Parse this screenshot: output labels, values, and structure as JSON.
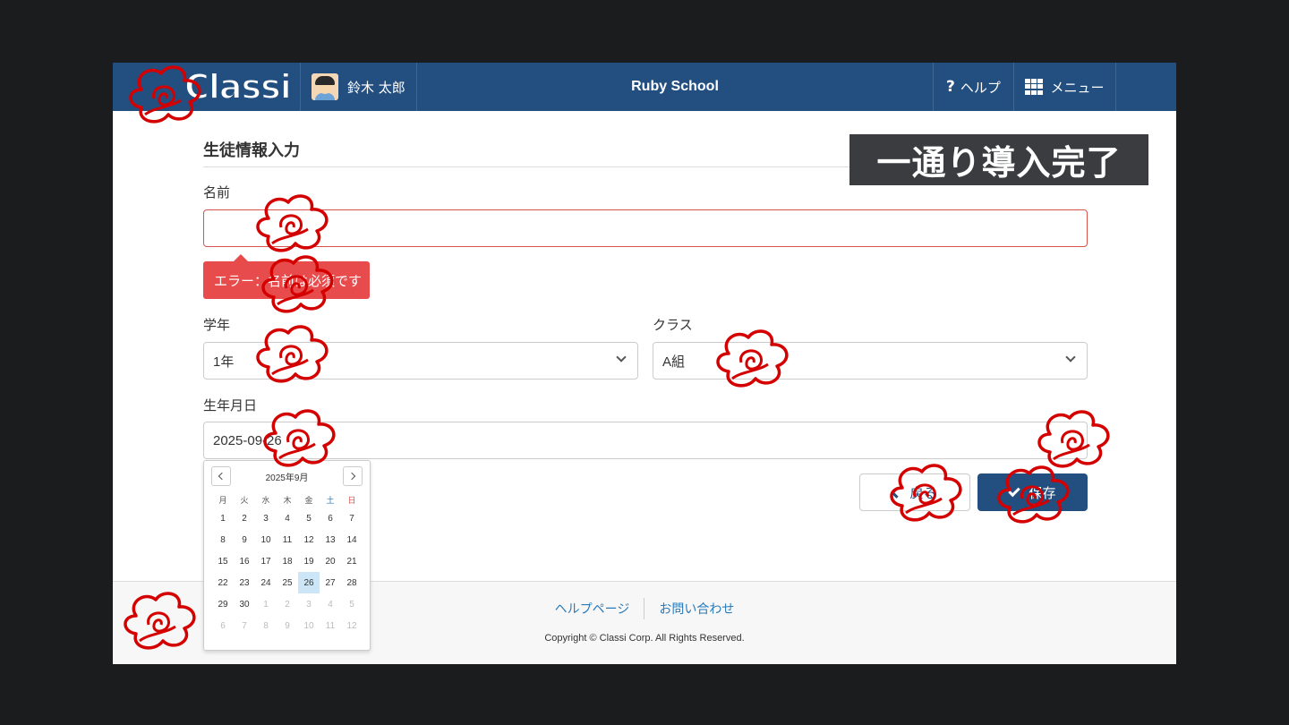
{
  "header": {
    "logo_text": "Classi",
    "user_name": "鈴木 太郎",
    "school_name": "Ruby School",
    "help_label": "ヘルプ",
    "menu_label": "メニュー"
  },
  "banner": "一通り導入完了",
  "form": {
    "section_title": "生徒情報入力",
    "name_label": "名前",
    "name_value": "",
    "error_tooltip": "エラー：名前は必須です",
    "grade_label": "学年",
    "grade_value": "1年",
    "class_label": "クラス",
    "class_value": "A組",
    "birthday_label": "生年月日",
    "birthday_value": "2025-09-26",
    "back_label": "戻る",
    "save_label": "保存"
  },
  "calendar": {
    "title": "2025年9月",
    "weekdays": [
      "月",
      "火",
      "水",
      "木",
      "金",
      "土",
      "日"
    ],
    "days": [
      [
        "1",
        "2",
        "3",
        "4",
        "5",
        "6",
        "7"
      ],
      [
        "8",
        "9",
        "10",
        "11",
        "12",
        "13",
        "14"
      ],
      [
        "15",
        "16",
        "17",
        "18",
        "19",
        "20",
        "21"
      ],
      [
        "22",
        "23",
        "24",
        "25",
        "26",
        "27",
        "28"
      ],
      [
        "29",
        "30",
        "1",
        "2",
        "3",
        "4",
        "5"
      ],
      [
        "6",
        "7",
        "8",
        "9",
        "10",
        "11",
        "12"
      ]
    ],
    "selected_day": "26"
  },
  "footer": {
    "help_page": "ヘルプページ",
    "contact": "お問い合わせ",
    "copyright": "Copyright © Classi Corp. All Rights Reserved."
  },
  "colors": {
    "header_bg": "#234f80",
    "error": "#e84b4b",
    "link": "#2a7ab8",
    "scribble": "#d40000"
  }
}
